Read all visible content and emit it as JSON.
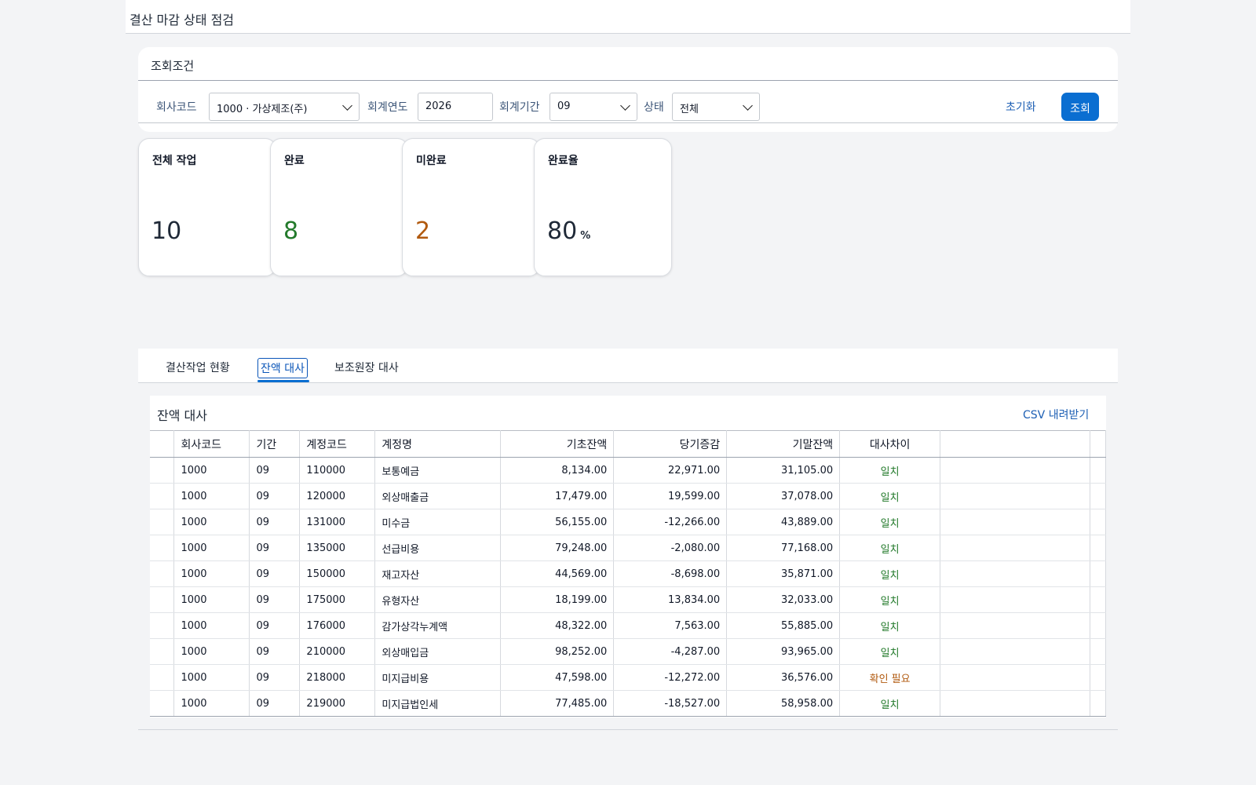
{
  "page": {
    "title": "결산 마감 상태 점검"
  },
  "filters": {
    "section_title": "조회조건",
    "company_label": "회사코드",
    "company_value": "1000 · 가상제조(주)",
    "year_label": "회계연도",
    "year_value": "2026",
    "period_label": "회계기간",
    "period_value": "09",
    "status_label": "상태",
    "status_value": "전체",
    "reset_label": "초기화",
    "search_label": "조회"
  },
  "kpis": [
    {
      "title": "전체 작업",
      "value": "10",
      "unit": "",
      "color": "#1f2937"
    },
    {
      "title": "완료",
      "value": "8",
      "unit": "",
      "color": "#237a2b"
    },
    {
      "title": "미완료",
      "value": "2",
      "unit": "",
      "color": "#b15a0f"
    },
    {
      "title": "완료율",
      "value": "80",
      "unit": "%",
      "color": "#1f2937"
    }
  ],
  "tabs": [
    {
      "label": "결산작업 현황",
      "active": false
    },
    {
      "label": "잔액 대사",
      "active": true
    },
    {
      "label": "보조원장 대사",
      "active": false
    }
  ],
  "table": {
    "title": "잔액 대사",
    "csv_label": "CSV 내려받기",
    "columns": [
      "회사코드",
      "기간",
      "계정코드",
      "계정명",
      "기초잔액",
      "당기증감",
      "기말잔액",
      "대사차이"
    ],
    "rows": [
      [
        "1000",
        "09",
        "110000",
        "보통예금",
        "8,134.00",
        "22,971.00",
        "31,105.00",
        "일치"
      ],
      [
        "1000",
        "09",
        "120000",
        "외상매출금",
        "17,479.00",
        "19,599.00",
        "37,078.00",
        "일치"
      ],
      [
        "1000",
        "09",
        "131000",
        "미수금",
        "56,155.00",
        "-12,266.00",
        "43,889.00",
        "일치"
      ],
      [
        "1000",
        "09",
        "135000",
        "선급비용",
        "79,248.00",
        "-2,080.00",
        "77,168.00",
        "일치"
      ],
      [
        "1000",
        "09",
        "150000",
        "재고자산",
        "44,569.00",
        "-8,698.00",
        "35,871.00",
        "일치"
      ],
      [
        "1000",
        "09",
        "175000",
        "유형자산",
        "18,199.00",
        "13,834.00",
        "32,033.00",
        "일치"
      ],
      [
        "1000",
        "09",
        "176000",
        "감가상각누계액",
        "48,322.00",
        "7,563.00",
        "55,885.00",
        "일치"
      ],
      [
        "1000",
        "09",
        "210000",
        "외상매입금",
        "98,252.00",
        "-4,287.00",
        "93,965.00",
        "일치"
      ],
      [
        "1000",
        "09",
        "218000",
        "미지급비용",
        "47,598.00",
        "-12,272.00",
        "36,576.00",
        "확인 필요"
      ],
      [
        "1000",
        "09",
        "219000",
        "미지급법인세",
        "77,485.00",
        "-18,527.00",
        "58,958.00",
        "일치"
      ]
    ]
  },
  "colors": {
    "accent": "#0a6ed1",
    "ok": "#237a2b",
    "warn": "#b15a0f"
  }
}
